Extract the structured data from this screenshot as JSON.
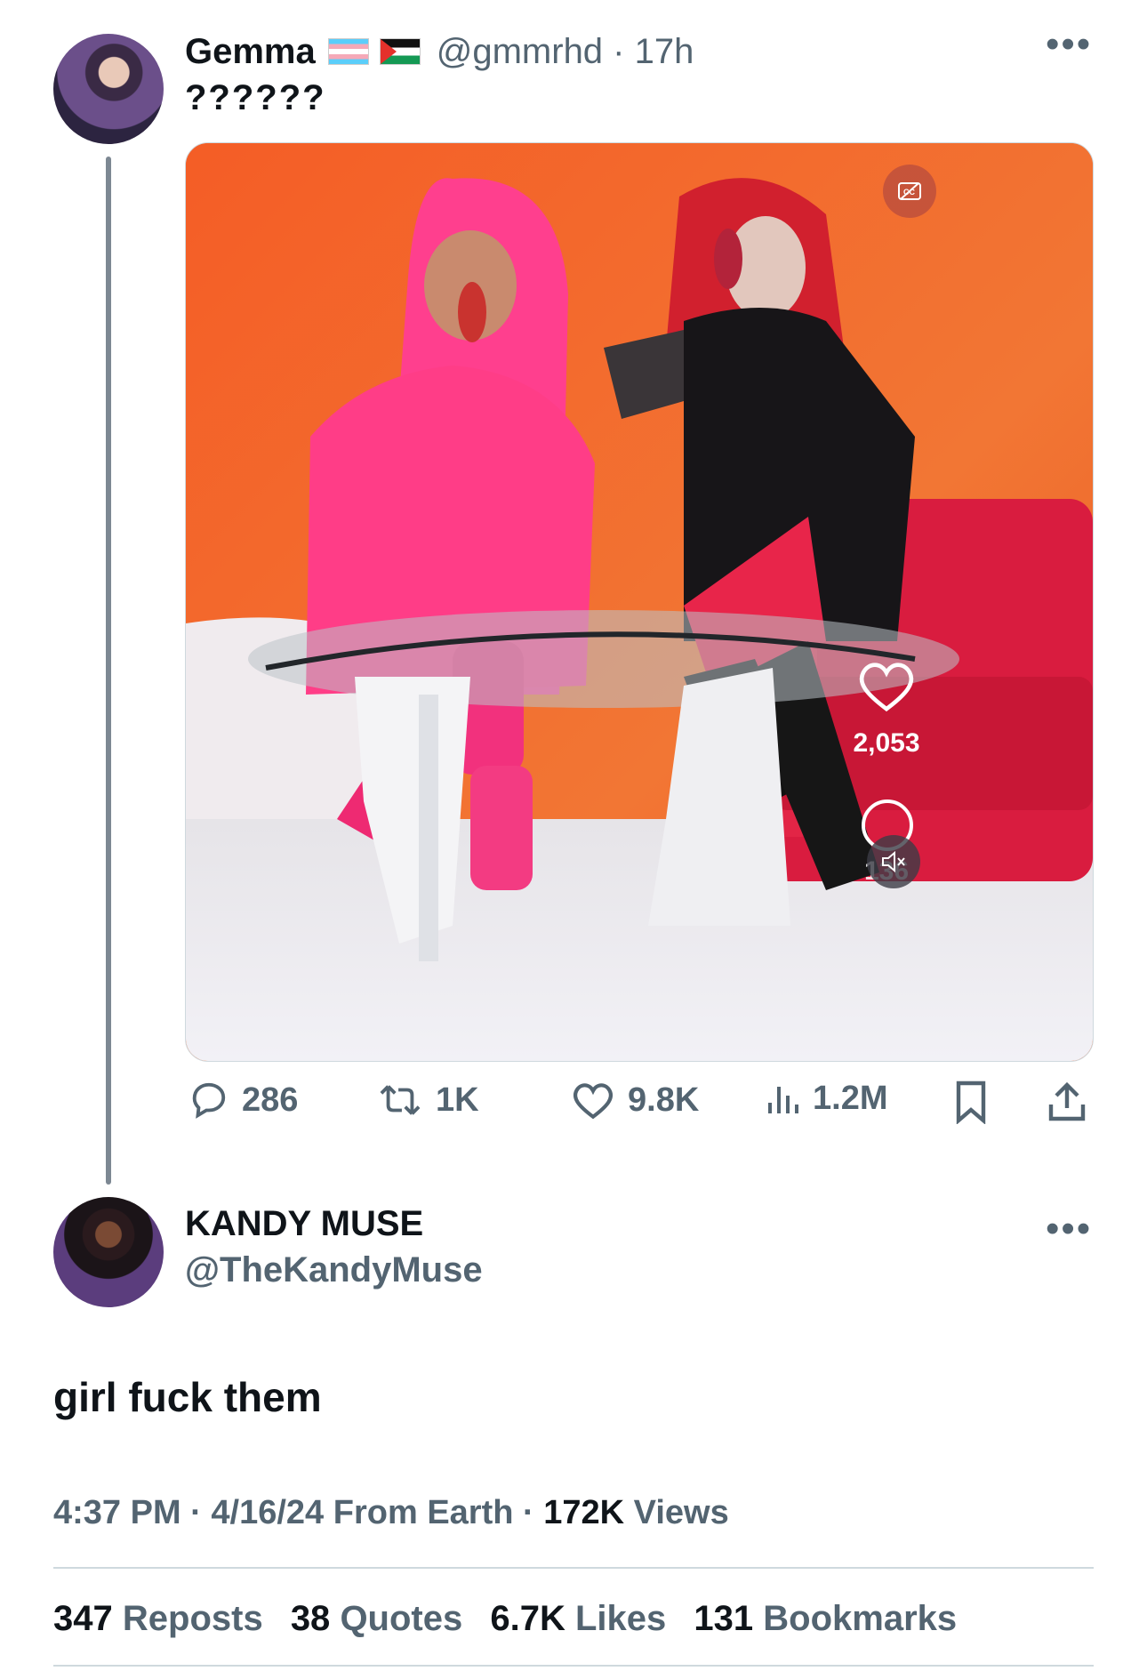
{
  "quoted_tweet": {
    "display_name": "Gemma",
    "handle_time": "@gmmrhd · 17h",
    "flags": [
      "transgender-flag-icon",
      "palestine-flag-icon"
    ],
    "text": "??????",
    "media": {
      "overlay_like_count": "2,053",
      "overlay_comment_count": "136",
      "icons": [
        "caption-off-icon",
        "heart-icon",
        "comment-icon",
        "mute-icon"
      ]
    },
    "actions": {
      "replies": "286",
      "reposts": "1K",
      "likes": "9.8K",
      "views": "1.2M"
    }
  },
  "main_tweet": {
    "display_name": "KANDY MUSE",
    "handle": "@TheKandyMuse",
    "text": "girl fuck them",
    "meta": {
      "time": "4:37 PM",
      "sep1": " · ",
      "date": "4/16/24",
      "source": "From Earth",
      "sep2": " · ",
      "views_count": "172K",
      "views_label": "Views"
    },
    "stats": {
      "reposts_count": "347",
      "reposts_label": "Reposts",
      "quotes_count": "38",
      "quotes_label": "Quotes",
      "likes_count": "6.7K",
      "likes_label": "Likes",
      "bookmarks_count": "131",
      "bookmarks_label": "Bookmarks"
    }
  },
  "colors": {
    "text": "#0f1419",
    "secondary": "#536471",
    "divider": "#cfd9de",
    "thread_line": "#7d8893",
    "video_orange": "#f2622a"
  }
}
